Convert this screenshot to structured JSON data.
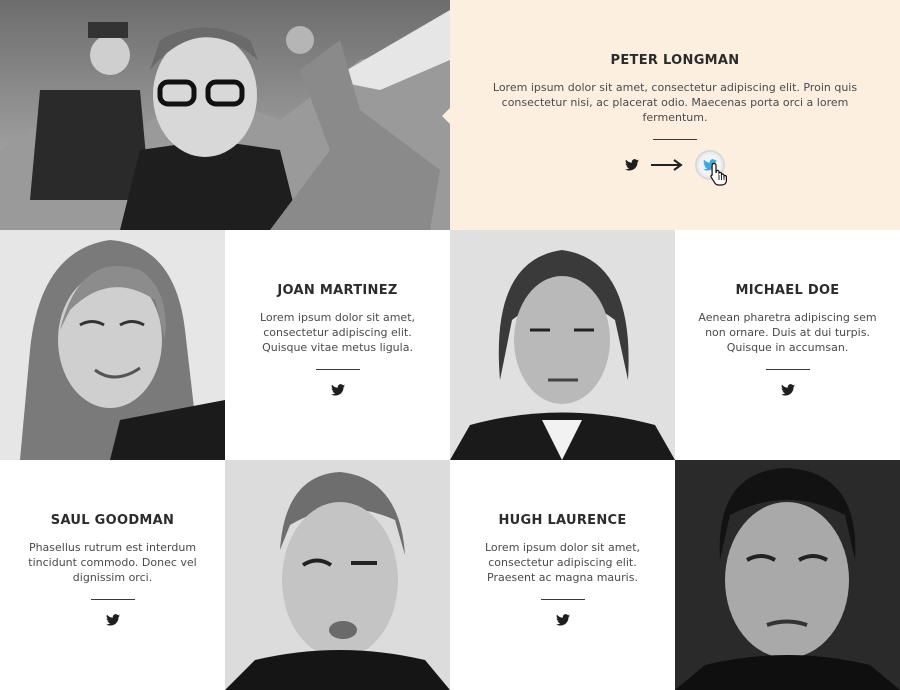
{
  "team": {
    "featured": {
      "name": "PETER LONGMAN",
      "bio": "Lorem ipsum dolor sit amet, consectetur adipiscing elit. Proin quis consectetur nisi, ac placerat odio. Maecenas porta orci a lorem fermentum."
    },
    "members": [
      {
        "name": "JOAN MARTINEZ",
        "bio": "Lorem ipsum dolor sit amet, consectetur adipiscing elit. Quisque vitae metus ligula."
      },
      {
        "name": "MICHAEL DOE",
        "bio": "Aenean pharetra adipiscing sem non ornare. Duis at dui turpis. Quisque in accumsan."
      },
      {
        "name": "SAUL GOODMAN",
        "bio": "Phasellus rutrum est interdum tincidunt commodo. Donec vel dignissim orci."
      },
      {
        "name": "HUGH LAURENCE",
        "bio": "Lorem ipsum dolor sit amet, consectetur adipiscing elit. Praesent ac magna mauris."
      }
    ]
  },
  "icons": {
    "social": "twitter-icon",
    "arrow": "arrow-right-icon",
    "cursor": "hand-pointer-icon",
    "photos": "portrait-photo"
  },
  "colors": {
    "featured_bg": "#fdefdf",
    "card_bg": "#ffffff",
    "twitter_active": "#3ea7e0",
    "text_dark": "#2b2b2b"
  }
}
